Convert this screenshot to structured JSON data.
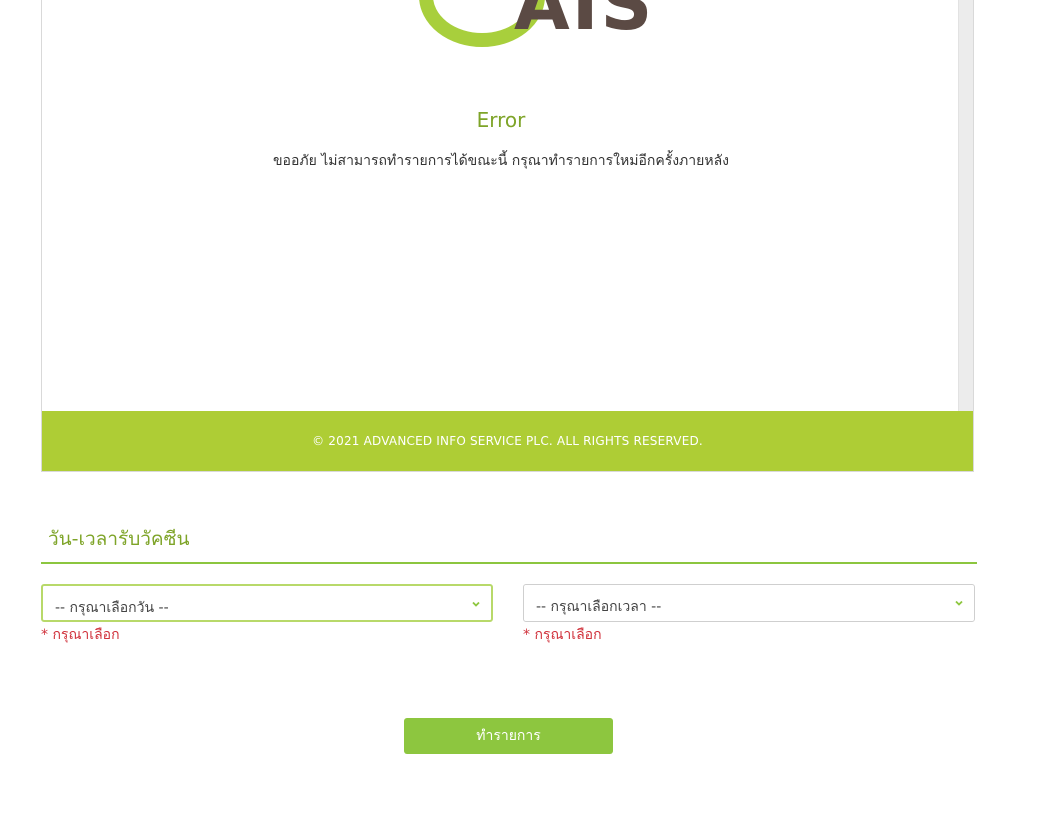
{
  "logo": {
    "text": "AIS",
    "colors": {
      "arc": "#a8cf3c",
      "wordmark": "#5b4a44"
    }
  },
  "error": {
    "title": "Error",
    "message": "ขออภัย ไม่สามารถทำรายการได้ขณะนี้ กรุณาทำรายการใหม่อีกครั้งภายหลัง"
  },
  "footer": {
    "copyright": "© 2021 ADVANCED INFO SERVICE PLC. ALL RIGHTS RESERVED."
  },
  "form": {
    "section_title": "วัน-เวลารับวัคซีน",
    "date_select": {
      "selected": "-- กรุณาเลือกวัน --",
      "error": "* กรุณาเลือก",
      "icon": "chevron-down-icon"
    },
    "time_select": {
      "selected": "-- กรุณาเลือกเวลา --",
      "error": "* กรุณาเลือก",
      "icon": "chevron-down-icon"
    },
    "submit_label": "ทำรายการ"
  },
  "colors": {
    "accent_green": "#aecd35",
    "button_green": "#8dc63f",
    "title_green": "#7ea428",
    "error_red": "#d0313b"
  }
}
